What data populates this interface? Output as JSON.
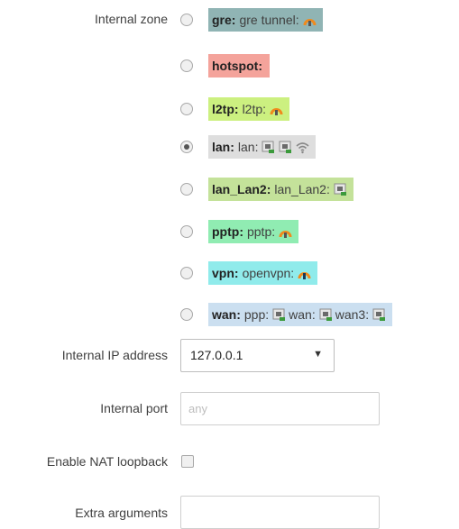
{
  "labels": {
    "internal_zone": "Internal zone",
    "internal_ip": "Internal IP address",
    "internal_port": "Internal port",
    "nat_loopback": "Enable NAT loopback",
    "extra_args": "Extra arguments"
  },
  "zones": [
    {
      "name": "gre:",
      "parts": [
        "gre tunnel:"
      ],
      "icons": [
        "tunnel-icon"
      ],
      "bg": "#90b4b4",
      "checked": false
    },
    {
      "name": "hotspot:",
      "parts": [],
      "icons": [],
      "bg": "#f4a39b",
      "checked": false
    },
    {
      "name": "l2tp:",
      "parts": [
        "l2tp:"
      ],
      "icons": [
        "tunnel-icon"
      ],
      "bg": "#ccf080",
      "checked": false
    },
    {
      "name": "lan:",
      "parts": [
        "lan:"
      ],
      "icons": [
        "ethernet-port-icon",
        "ethernet-port-icon",
        "wifi-icon"
      ],
      "bg": "#dedede",
      "checked": true
    },
    {
      "name": "lan_Lan2:",
      "parts": [
        "lan_Lan2:"
      ],
      "icons": [
        "ethernet-port-icon"
      ],
      "bg": "#c4e29a",
      "checked": false
    },
    {
      "name": "pptp:",
      "parts": [
        "pptp:"
      ],
      "icons": [
        "tunnel-icon"
      ],
      "bg": "#90ecb2",
      "checked": false
    },
    {
      "name": "vpn:",
      "parts": [
        "openvpn:"
      ],
      "icons": [
        "vpn-tunnel-icon"
      ],
      "bg": "#90ebeb",
      "checked": false
    },
    {
      "name": "wan:",
      "parts": [
        "ppp:",
        "wan:",
        "wan3:"
      ],
      "icons": [
        "ethernet-port-icon",
        "ethernet-port-icon",
        "ethernet-port-icon"
      ],
      "bg": "#cbdff0",
      "checked": false
    }
  ],
  "internal_ip": {
    "value": "127.0.0.1",
    "caret": "▼"
  },
  "internal_port": {
    "value": "",
    "placeholder": "any"
  },
  "nat_loopback": {
    "checked": false
  },
  "extra_args": {
    "value": "",
    "placeholder": ""
  }
}
